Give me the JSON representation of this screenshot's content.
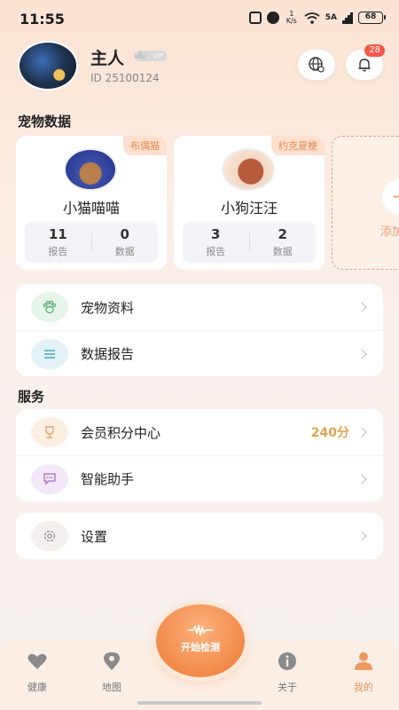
{
  "status_bar": {
    "time": "11:55",
    "speed": "1\nK/s",
    "network": "5A",
    "battery": "68"
  },
  "profile": {
    "name": "主人",
    "vip_label": "VIP",
    "id_text": "ID 25100124",
    "notification_count": "28"
  },
  "pet_section": {
    "title": "宠物数据",
    "pets": [
      {
        "tag": "布偶猫",
        "name": "小猫喵喵",
        "reports": "11",
        "reports_label": "报告",
        "data": "0",
        "data_label": "数据"
      },
      {
        "tag": "约克夏梗",
        "name": "小狗汪汪",
        "reports": "3",
        "reports_label": "报告",
        "data": "2",
        "data_label": "数据"
      }
    ],
    "add_label": "添加"
  },
  "menu_main": [
    {
      "label": "宠物资料",
      "icon": "paw-icon"
    },
    {
      "label": "数据报告",
      "icon": "list-icon"
    }
  ],
  "services": {
    "title": "服务",
    "items": [
      {
        "label": "会员积分中心",
        "value": "240分",
        "icon": "trophy-icon"
      },
      {
        "label": "智能助手",
        "icon": "chat-icon"
      }
    ]
  },
  "settings": {
    "label": "设置",
    "icon": "gear-icon"
  },
  "tabbar": {
    "start_label": "开始检测",
    "tabs": [
      {
        "label": "健康",
        "icon": "heart-icon"
      },
      {
        "label": "地图",
        "icon": "map-pin-icon"
      },
      {
        "label": "关于",
        "icon": "info-icon"
      },
      {
        "label": "我的",
        "icon": "person-icon"
      }
    ]
  },
  "colors": {
    "accent": "#f28a4b",
    "tag_bg": "#fde0cf",
    "points": "#e2a152"
  }
}
